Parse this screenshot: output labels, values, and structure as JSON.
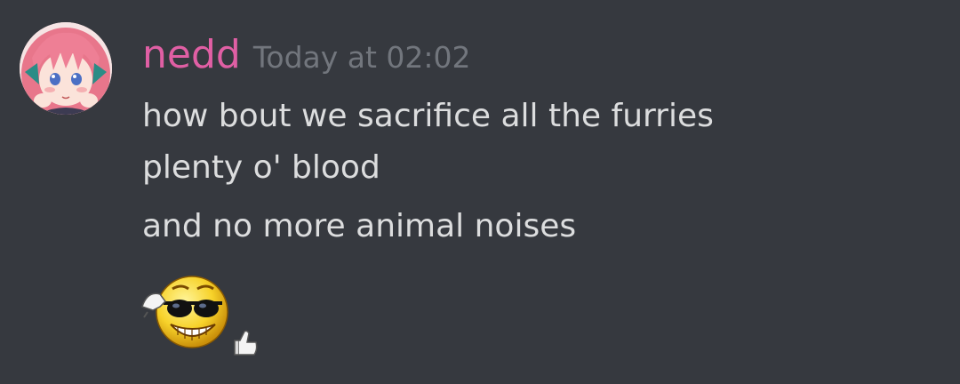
{
  "message": {
    "author": "nedd",
    "author_color": "#e05fa4",
    "timestamp": "Today at 02:02",
    "lines": [
      "how bout we sacrifice all the furries",
      "plenty o' blood",
      "and no more animal noises"
    ],
    "avatar_icon": "anime-girl-pink-hair-avatar",
    "emoji_icon": "cool-sunglasses-thumbs-up-emoji"
  },
  "colors": {
    "background": "#36393f",
    "text": "#dcddde",
    "timestamp": "#72767d"
  }
}
